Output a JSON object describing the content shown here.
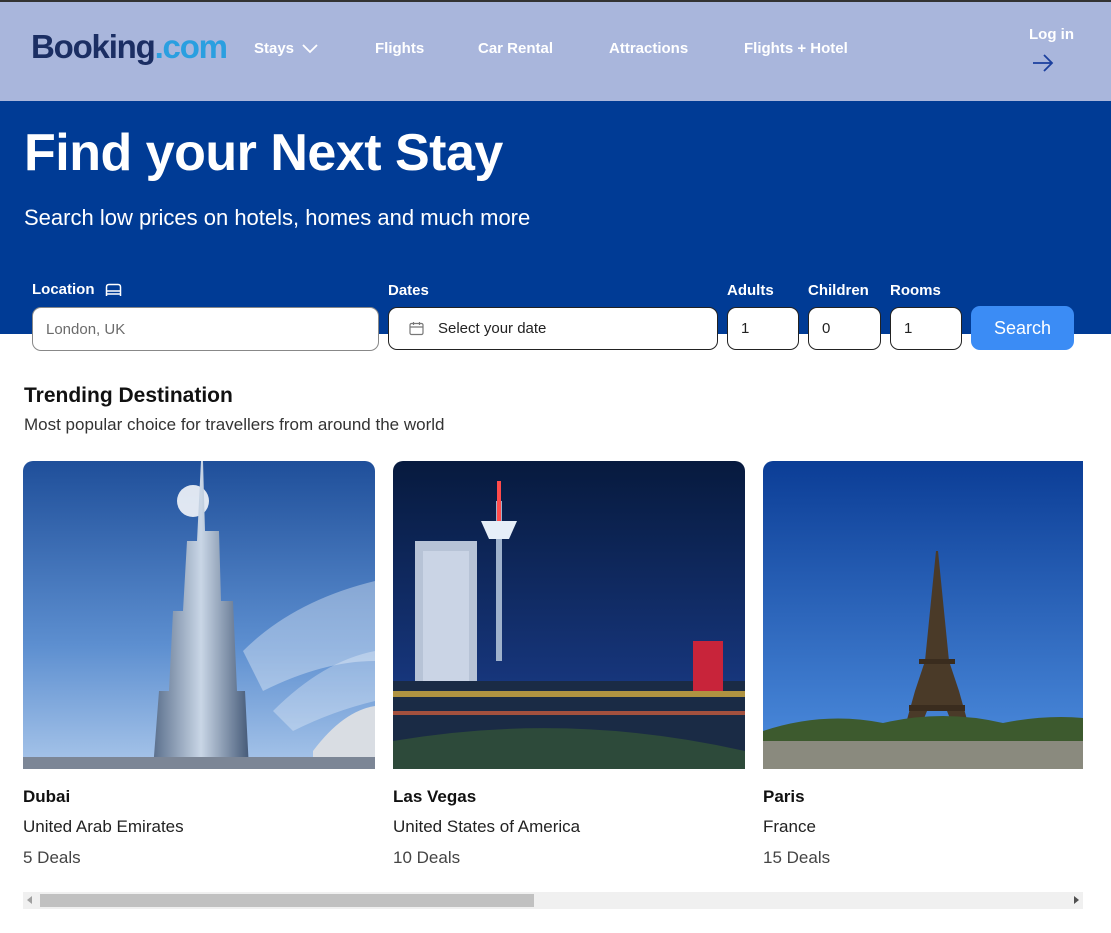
{
  "brand": {
    "part1": "Booking",
    "part2": ".com"
  },
  "nav": {
    "items": [
      {
        "label": "Stays",
        "icon": "chevron-down-icon"
      },
      {
        "label": "Flights"
      },
      {
        "label": "Car Rental"
      },
      {
        "label": "Attractions"
      },
      {
        "label": "Flights + Hotel"
      }
    ],
    "login_label": "Log in",
    "login_icon": "arrow-right-icon"
  },
  "hero": {
    "title": "Find your Next Stay",
    "subtitle": "Search low prices on hotels, homes and much more"
  },
  "search": {
    "location_label": "Location",
    "location_icon": "bed-icon",
    "location_placeholder": "London, UK",
    "dates_label": "Dates",
    "dates_icon": "calendar-icon",
    "dates_placeholder": "Select your date",
    "adults_label": "Adults",
    "adults_value": "1",
    "children_label": "Children",
    "children_value": "0",
    "rooms_label": "Rooms",
    "rooms_value": "1",
    "button_label": "Search"
  },
  "trending": {
    "title": "Trending Destination",
    "subtitle": "Most popular choice for travellers from around the world",
    "cards": [
      {
        "city": "Dubai",
        "country": "United Arab Emirates",
        "deals": "5 Deals"
      },
      {
        "city": "Las Vegas",
        "country": "United States of America",
        "deals": "10 Deals"
      },
      {
        "city": "Paris",
        "country": "France",
        "deals": "15 Deals"
      }
    ]
  },
  "colors": {
    "header_bg": "#a9b6dc",
    "hero_bg": "#003b95",
    "brand_dark": "#1b2e63",
    "brand_light": "#2a9fe0",
    "search_button": "#3b8cf5"
  }
}
